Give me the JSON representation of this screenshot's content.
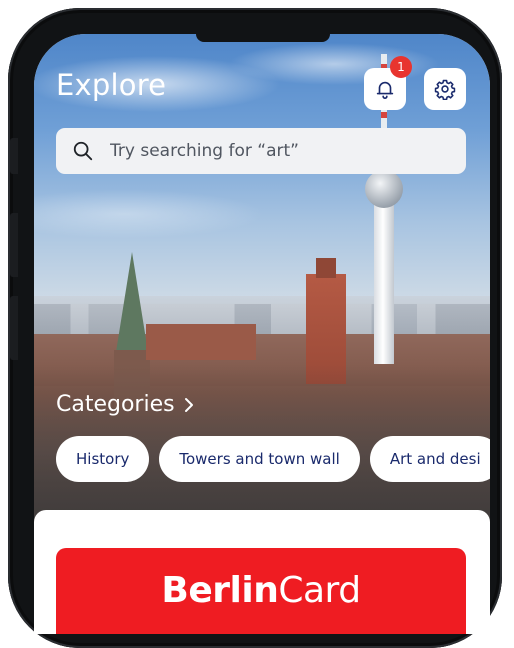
{
  "header": {
    "title": "Explore",
    "notification_count": "1",
    "bell_icon": "bell-icon",
    "settings_icon": "gear-icon"
  },
  "search": {
    "placeholder": "Try searching for “art”",
    "icon": "search-icon"
  },
  "categories": {
    "heading": "Categories",
    "chevron_icon": "chevron-right-icon",
    "chips": [
      "History",
      "Towers and town wall",
      "Art and desi"
    ]
  },
  "promo": {
    "brand_bold": "Berlin",
    "brand_light": "Card"
  },
  "colors": {
    "chip_text": "#1a2a6c",
    "badge": "#e8342f",
    "berlin_card_red": "#ef1c22"
  }
}
